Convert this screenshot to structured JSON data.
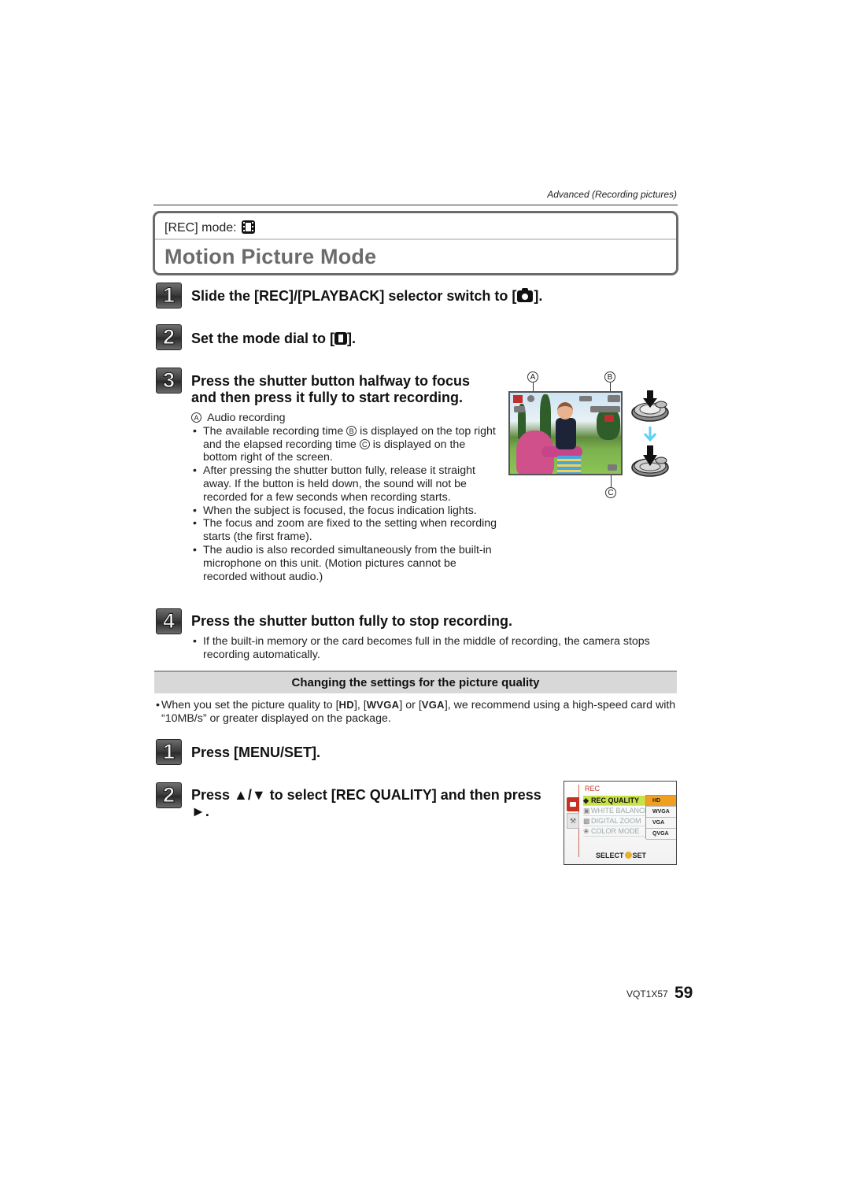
{
  "header": {
    "section": "Advanced (Recording pictures)"
  },
  "title_box": {
    "mode_label": "[REC] mode:",
    "mode_icon": "motion-picture-mode-icon",
    "title": "Motion Picture Mode"
  },
  "steps": [
    {
      "number": "1",
      "text_before": "Slide the [REC]/[PLAYBACK] selector switch to [",
      "icon": "camera-icon",
      "text_after": "]."
    },
    {
      "number": "2",
      "text_before": "Set the mode dial to [",
      "icon": "motion-picture-icon",
      "text_after": "]."
    },
    {
      "number": "3",
      "line1": "Press the shutter button halfway to focus",
      "line2": "and then press it fully to start recording.",
      "callout_a": "A",
      "callout_a_text": "Audio recording",
      "bullets": [
        {
          "part1": "The available recording time ",
          "marker": "B",
          "part2": " is displayed on the top right and the elapsed recording time ",
          "marker2": "C",
          "part3": " is displayed on the bottom right of the screen."
        },
        {
          "text": "After pressing the shutter button fully, release it straight away. If the button is held down, the sound will not be recorded for a few seconds when recording starts."
        },
        {
          "text": "When the subject is focused, the focus indication lights."
        },
        {
          "text": "The focus and zoom are fixed to the setting when recording starts (the first frame)."
        },
        {
          "text": "The audio is also recorded simultaneously from the built-in microphone on this unit. (Motion pictures cannot be recorded without audio.)"
        }
      ]
    },
    {
      "number": "4",
      "text": "Press the shutter button fully to stop recording.",
      "bullets": [
        {
          "text": "If the built-in memory or the card becomes full in the middle of recording, the camera stops recording automatically."
        }
      ]
    }
  ],
  "illustration": {
    "labels": [
      "A",
      "B",
      "C"
    ],
    "description": "camera LCD preview with shutter button half-press then full-press",
    "arrow_color": "#5fd0f0"
  },
  "quality_section": {
    "title": "Changing the settings for the picture quality",
    "note_part1": "When you set the picture quality to [",
    "q1": "HD",
    "note_part2": "], [",
    "q2": "WVGA",
    "note_part3": "] or [",
    "q3": "VGA",
    "note_part4": "], we recommend using a high-speed card with “10MB/s” or greater displayed on the package.",
    "steps": [
      {
        "number": "1",
        "text": "Press [MENU/SET]."
      },
      {
        "number": "2",
        "line1": "Press ▲/▼ to select [REC QUALITY] and then press",
        "line2": "►."
      }
    ]
  },
  "menu_screen": {
    "title": "REC",
    "items": [
      {
        "icon": "◆",
        "label": "REC QUALITY",
        "selected": true
      },
      {
        "icon": "▣",
        "label": "WHITE BALANCE",
        "selected": false
      },
      {
        "icon": "▩",
        "label": "DIGITAL ZOOM",
        "selected": false
      },
      {
        "icon": "❀",
        "label": "COLOR MODE",
        "selected": false
      }
    ],
    "options": [
      {
        "label": "HD",
        "selected": true
      },
      {
        "label": "WVGA",
        "selected": false
      },
      {
        "label": "VGA",
        "selected": false
      },
      {
        "label": "QVGA",
        "selected": false
      }
    ],
    "footer_select": "SELECT",
    "footer_set": "SET",
    "colors": {
      "highlight": "#c8e04a",
      "option_selected": "#f0a020",
      "tab": "#c8301f"
    }
  },
  "footer": {
    "code": "VQT1X57",
    "page": "59"
  }
}
